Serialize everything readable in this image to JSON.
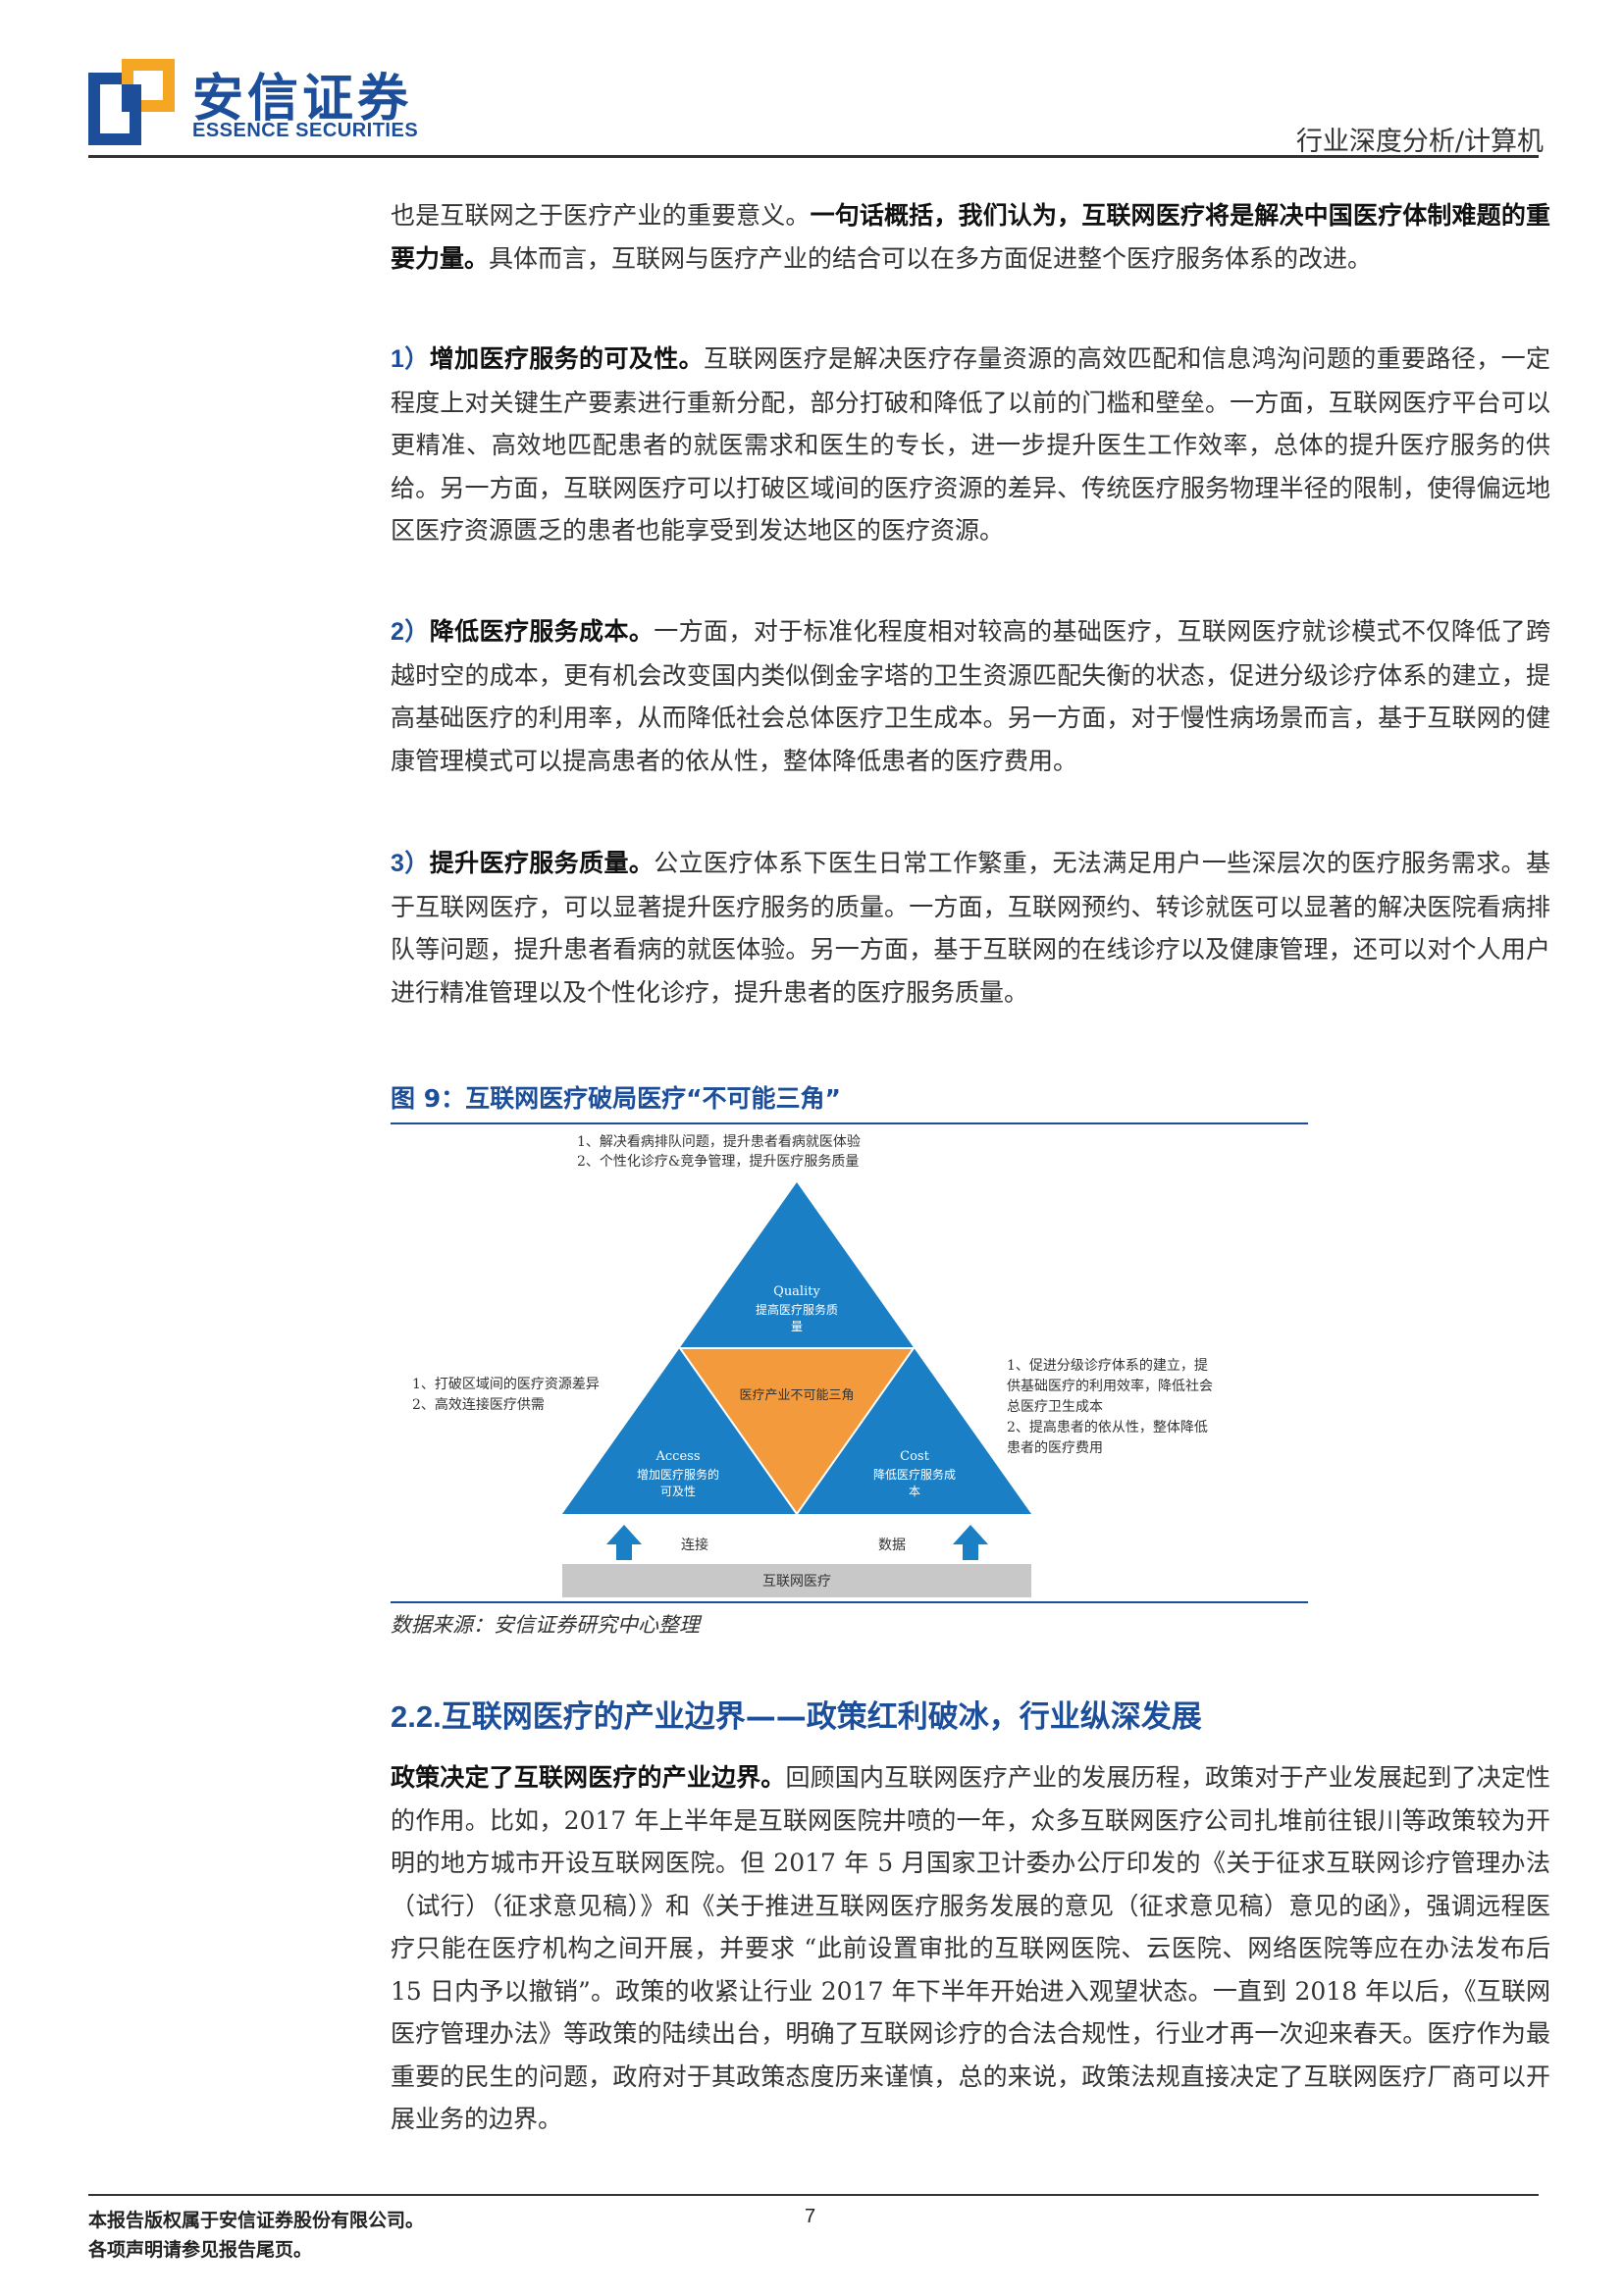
{
  "header": {
    "logo_cn": "安信证券",
    "logo_en": "ESSENCE SECURITIES",
    "category": "行业深度分析/计算机",
    "brand_color": "#1c4e9a",
    "accent_color": "#f5a623"
  },
  "intro": {
    "plain1": "也是互联网之于医疗产业的重要意义。",
    "bold": "一句话概括，我们认为，互联网医疗将是解决中国医疗体制难题的重要力量。",
    "plain2": "具体而言，互联网与医疗产业的结合可以在多方面促进整个医疗服务体系的改进。"
  },
  "points": [
    {
      "num": "1）",
      "title": "增加医疗服务的可及性。",
      "text": "互联网医疗是解决医疗存量资源的高效匹配和信息鸿沟问题的重要路径，一定程度上对关键生产要素进行重新分配，部分打破和降低了以前的门槛和壁垒。一方面，互联网医疗平台可以更精准、高效地匹配患者的就医需求和医生的专长，进一步提升医生工作效率，总体的提升医疗服务的供给。另一方面，互联网医疗可以打破区域间的医疗资源的差异、传统医疗服务物理半径的限制，使得偏远地区医疗资源匮乏的患者也能享受到发达地区的医疗资源。"
    },
    {
      "num": "2）",
      "title": "降低医疗服务成本。",
      "text": "一方面，对于标准化程度相对较高的基础医疗，互联网医疗就诊模式不仅降低了跨越时空的成本，更有机会改变国内类似倒金字塔的卫生资源匹配失衡的状态，促进分级诊疗体系的建立，提高基础医疗的利用率，从而降低社会总体医疗卫生成本。另一方面，对于慢性病场景而言，基于互联网的健康管理模式可以提高患者的依从性，整体降低患者的医疗费用。"
    },
    {
      "num": "3）",
      "title": "提升医疗服务质量。",
      "text": "公立医疗体系下医生日常工作繁重，无法满足用户一些深层次的医疗服务需求。基于互联网医疗，可以显著提升医疗服务的质量。一方面，互联网预约、转诊就医可以显著的解决医院看病排队等问题，提升患者看病的就医体验。另一方面，基于互联网的在线诊疗以及健康管理，还可以对个人用户进行精准管理以及个性化诊疗，提升患者的医疗服务质量。"
    }
  ],
  "figure": {
    "title": "图 9：互联网医疗破局医疗“不可能三角”",
    "top_note_1": "1、解决看病排队问题，提升患者看病就医体验",
    "top_note_2": "2、个性化诊疗&竞争管理，提升医疗服务质量",
    "left_note_1": "1、打破区域间的医疗资源差异",
    "left_note_2": "2、高效连接医疗供需",
    "right_note_1": "1、促进分级诊疗体系的建立，提",
    "right_note_2": "供基础医疗的利用效率，降低社会",
    "right_note_3": "总医疗卫生成本",
    "right_note_4": "2、提高患者的依从性，整体降低",
    "right_note_5": "患者的医疗费用",
    "quality_en": "Quality",
    "quality_cn_1": "提高医疗服务质",
    "quality_cn_2": "量",
    "center_label": "医疗产业不可能三角",
    "access_en": "Access",
    "access_cn_1": "增加医疗服务的",
    "access_cn_2": "可及性",
    "cost_en": "Cost",
    "cost_cn_1": "降低医疗服务成",
    "cost_cn_2": "本",
    "connect_label": "连接",
    "data_label": "数据",
    "base_label": "互联网医疗",
    "source": "数据来源：安信证券研究中心整理",
    "triangle_color": "#1b7fc6",
    "center_color": "#f39a3c",
    "base_color": "#c8c8c8"
  },
  "section": {
    "number": "2.2.",
    "title": "互联网医疗的产业边界——政策红利破冰，行业纵深发展"
  },
  "policy": {
    "bold": "政策决定了互联网医疗的产业边界。",
    "text": "回顾国内互联网医疗产业的发展历程，政策对于产业发展起到了决定性的作用。比如，2017 年上半年是互联网医院井喷的一年，众多互联网医疗公司扎堆前往银川等政策较为开明的地方城市开设互联网医院。但 2017 年 5 月国家卫计委办公厅印发的《关于征求互联网诊疗管理办法（试行）（征求意见稿）》和《关于推进互联网医疗服务发展的意见（征求意见稿）意见的函》，强调远程医疗只能在医疗机构之间开展，并要求 “此前设置审批的互联网医院、云医院、网络医院等应在办法发布后 15 日内予以撤销”。政策的收紧让行业 2017 年下半年开始进入观望状态。一直到 2018 年以后，《互联网医疗管理办法》等政策的陆续出台，明确了互联网诊疗的合法合规性，行业才再一次迎来春天。医疗作为最重要的民生的问题，政府对于其政策态度历来谨慎，总的来说，政策法规直接决定了互联网医疗厂商可以开展业务的边界。"
  },
  "footer": {
    "line1": "本报告版权属于安信证券股份有限公司。",
    "line2": "各项声明请参见报告尾页。",
    "page": "7"
  }
}
